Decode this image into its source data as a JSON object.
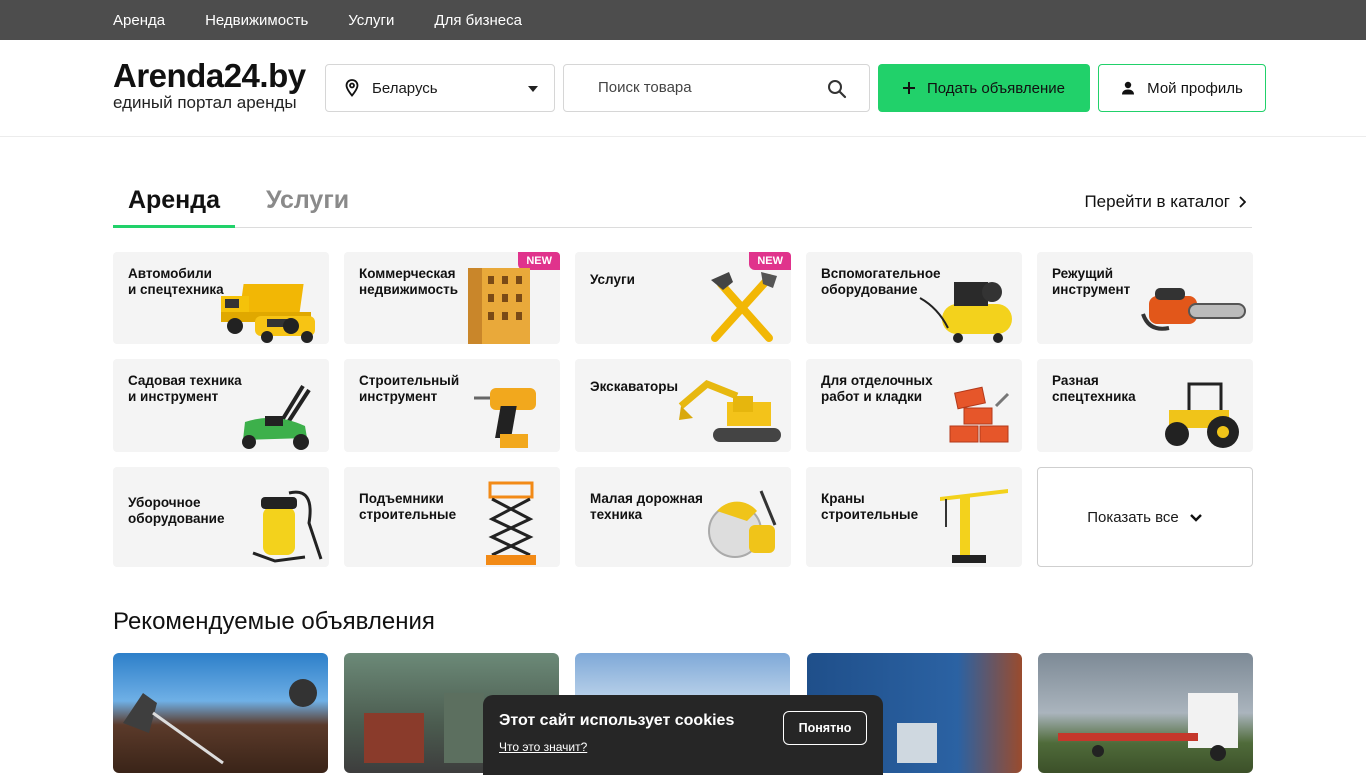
{
  "topnav": {
    "items": [
      "Аренда",
      "Недвижимость",
      "Услуги",
      "Для бизнеса"
    ]
  },
  "header": {
    "logo_title": "Arenda24.by",
    "logo_subtitle": "единый портал аренды",
    "region": "Беларусь",
    "search_placeholder": "Поиск товара",
    "post_label": "Подать объявление",
    "profile_label": "Мой профиль"
  },
  "tabs": {
    "active": "Аренда",
    "second": "Услуги",
    "catalog_link": "Перейти в каталог"
  },
  "categories": [
    {
      "label": "Автомобили\nи спецтехника",
      "icon": "truck-icon"
    },
    {
      "label": "Коммерческая\nнедвижимость",
      "icon": "building-icon",
      "badge": "NEW"
    },
    {
      "label": "Услуги",
      "icon": "tools-icon",
      "badge": "NEW"
    },
    {
      "label": "Вспомогательное\nоборудование",
      "icon": "compressor-icon"
    },
    {
      "label": "Режущий\nинструмент",
      "icon": "chainsaw-icon"
    },
    {
      "label": "Садовая техника\nи инструмент",
      "icon": "lawnmower-icon"
    },
    {
      "label": "Строительный\nинструмент",
      "icon": "drill-icon"
    },
    {
      "label": "Экскаваторы",
      "icon": "excavator-icon"
    },
    {
      "label": "Для отделочных\nработ и кладки",
      "icon": "bricks-icon"
    },
    {
      "label": "Разная\nспецтехника",
      "icon": "tractor-icon"
    },
    {
      "label": "Уборочное\nоборудование",
      "icon": "vacuum-icon"
    },
    {
      "label": "Подъемники\nстроительные",
      "icon": "scissor-lift-icon"
    },
    {
      "label": "Малая дорожная\nтехника",
      "icon": "road-saw-icon"
    },
    {
      "label": "Краны\nстроительные",
      "icon": "crane-icon"
    }
  ],
  "show_all": "Показать все",
  "recommended_title": "Рекомендуемые объявления",
  "cookie": {
    "title": "Этот сайт использует cookies",
    "link": "Что это значит?",
    "button": "Понятно"
  },
  "colors": {
    "accent": "#21d16a",
    "badge": "#e0338c",
    "topnav": "#4d4d4d"
  }
}
